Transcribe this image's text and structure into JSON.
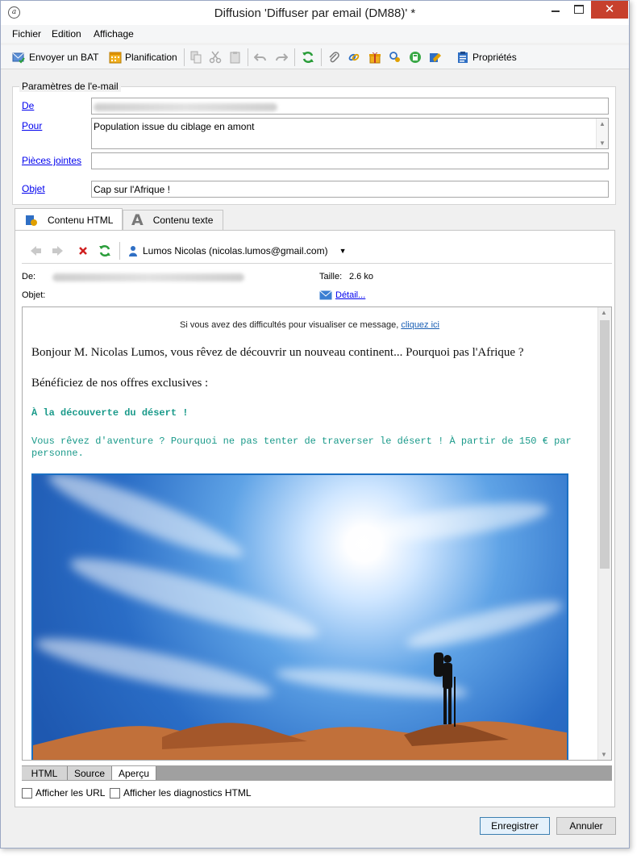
{
  "window": {
    "title": "Diffusion 'Diffuser par email (DM88)' *"
  },
  "menu": {
    "items": [
      "Fichier",
      "Edition",
      "Affichage"
    ]
  },
  "toolbar": {
    "send_bat": "Envoyer un BAT",
    "planning": "Planification",
    "properties": "Propriétés"
  },
  "email_params": {
    "legend": "Paramètres de l'e-mail",
    "from_label": "De",
    "to_label": "Pour",
    "to_value": "Population issue du ciblage en amont",
    "attachments_label": "Pièces jointes",
    "attachments_value": "",
    "subject_label": "Objet",
    "subject_value": "Cap sur l'Afrique !"
  },
  "tabs": {
    "html": "Contenu HTML",
    "text": "Contenu texte"
  },
  "preview_toolbar": {
    "recipient": "Lumos Nicolas (nicolas.lumos@gmail.com)"
  },
  "meta": {
    "from_label": "De:",
    "subject_label": "Objet:",
    "size_label": "Taille:",
    "size_value": "2.6 ko",
    "detail_link": "Détail..."
  },
  "mail": {
    "top_text": "Si vous avez des difficultés pour visualiser ce message,",
    "top_link": "cliquez ici",
    "greeting": "Bonjour M. Nicolas Lumos, vous rêvez de découvrir un nouveau continent... Pourquoi pas l'Afrique ?",
    "offers": "Bénéficiez de nos offres exclusives :",
    "heading": "À la découverte du désert !",
    "desc_line1": "Vous rêvez d'aventure ? Pourquoi ne pas tenter de traverser le désert ! À partir de 150 € par",
    "desc_line2": "personne."
  },
  "bottom_tabs": [
    "HTML",
    "Source",
    "Aperçu"
  ],
  "options": {
    "show_urls": "Afficher les URL",
    "show_diag": "Afficher les diagnostics HTML"
  },
  "buttons": {
    "save": "Enregistrer",
    "cancel": "Annuler"
  },
  "colors": {
    "link": "#0000ee",
    "teal_text": "#1a9a8a",
    "close_red": "#c7402d",
    "image_border": "#1b6fc2"
  }
}
